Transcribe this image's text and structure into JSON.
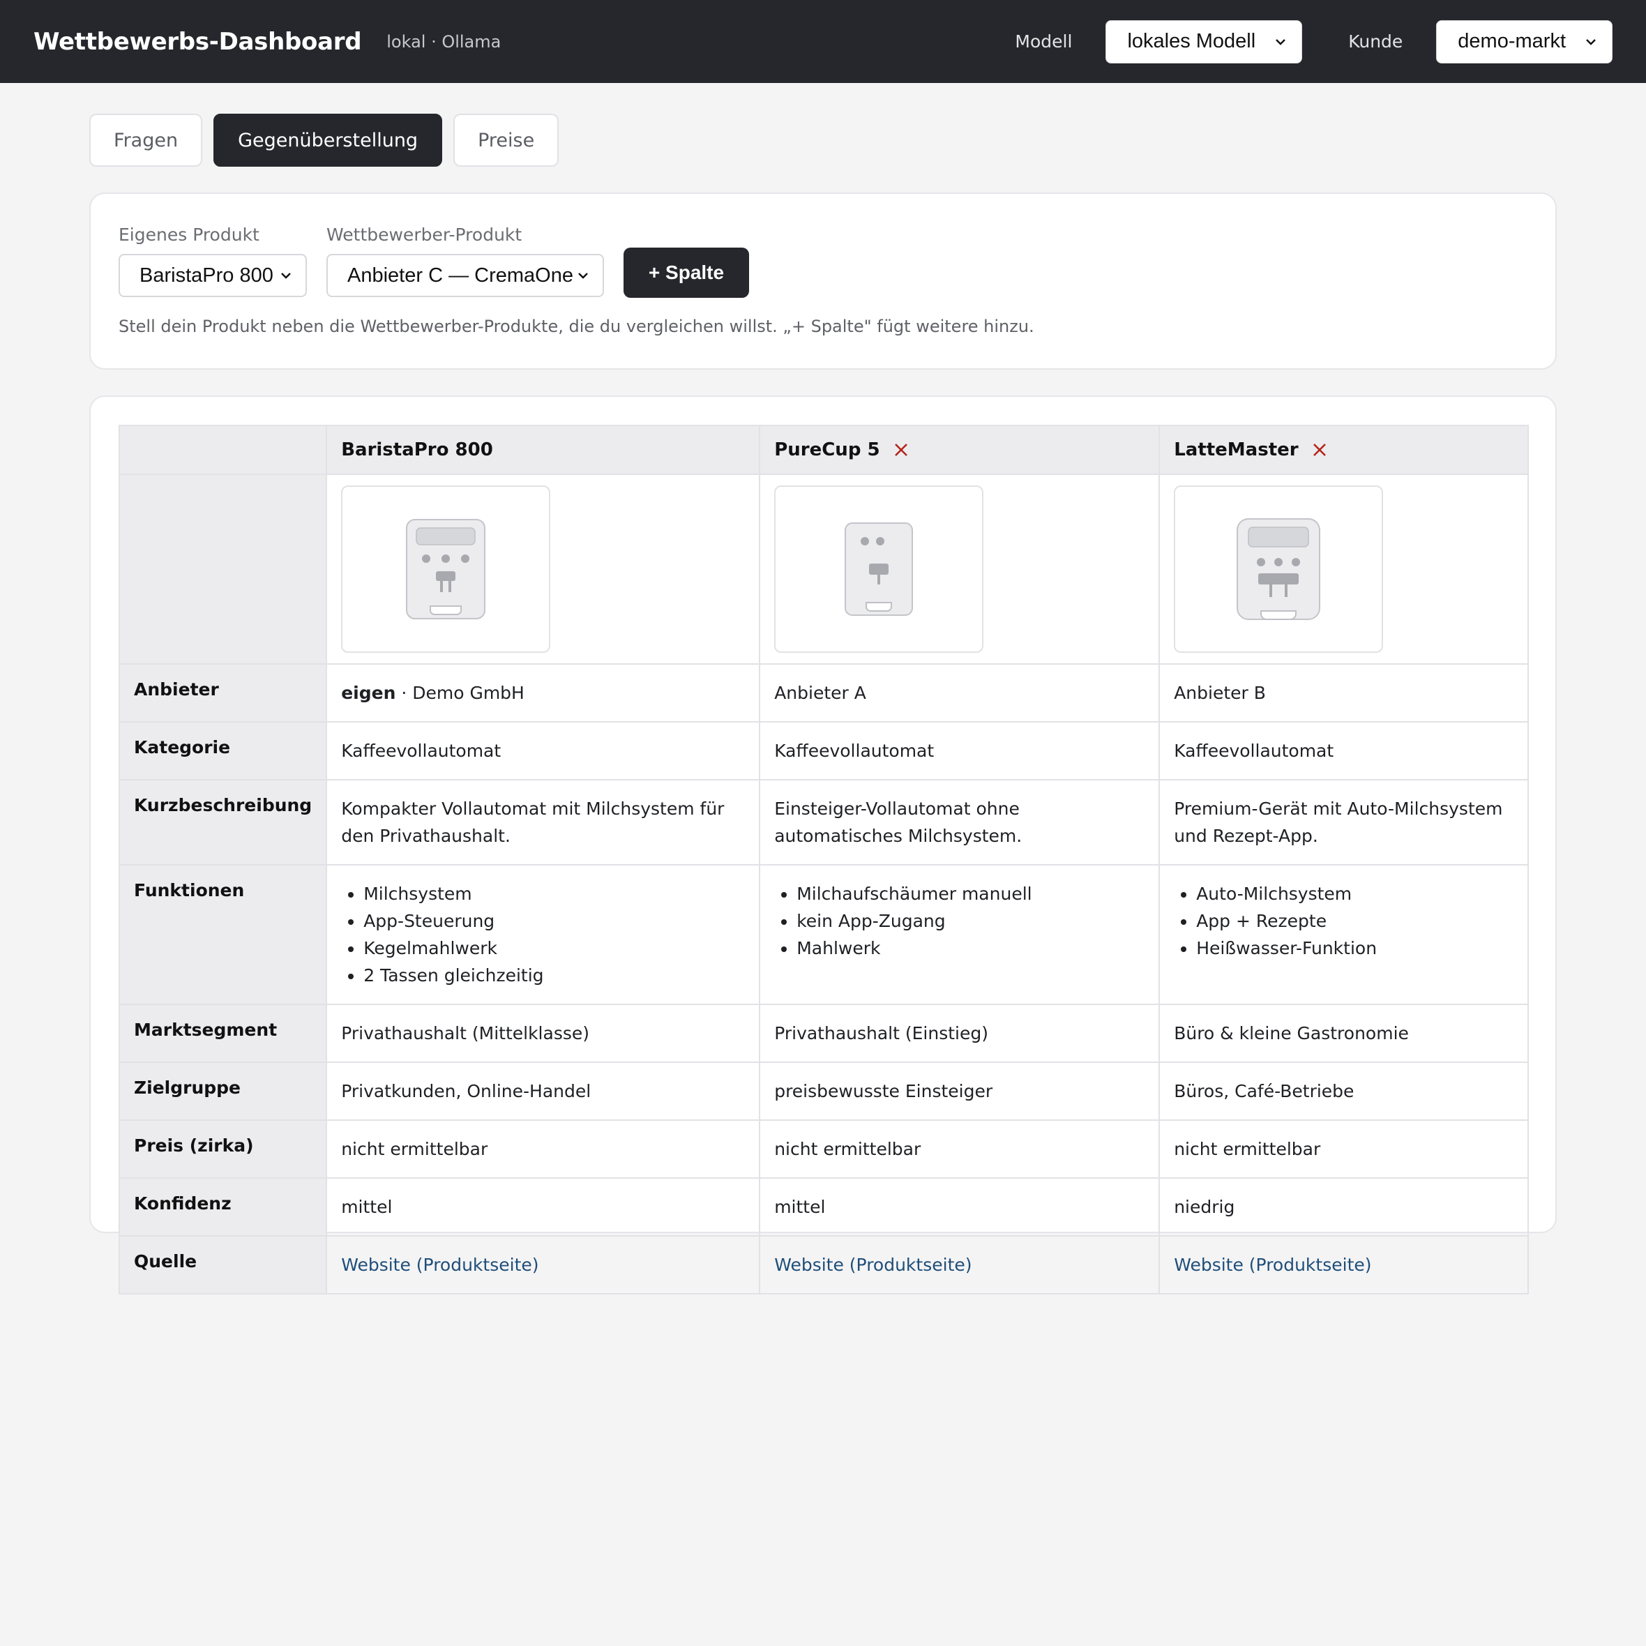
{
  "topbar": {
    "title": "Wettbewerbs-Dashboard",
    "subtitle": "lokal · Ollama",
    "model_label": "Modell",
    "model_value": "lokales Modell",
    "customer_label": "Kunde",
    "customer_value": "demo-markt"
  },
  "tabs": [
    {
      "label": "Fragen",
      "active": false
    },
    {
      "label": "Gegenüberstellung",
      "active": true
    },
    {
      "label": "Preise",
      "active": false
    }
  ],
  "filter": {
    "own_label": "Eigenes Produkt",
    "own_value": "BaristaPro 800",
    "competitor_label": "Wettbewerber-Produkt",
    "competitor_value": "Anbieter C — CremaOne",
    "add_button": "+ Spalte",
    "hint": "Stell dein Produkt neben die Wettbewerber-Produkte, die du vergleichen willst. „+ Spalte\" fügt weitere hinzu."
  },
  "table": {
    "rows": {
      "anbieter": "Anbieter",
      "kategorie": "Kategorie",
      "kurzbeschreibung": "Kurzbeschreibung",
      "funktionen": "Funktionen",
      "marktsegment": "Marktsegment",
      "zielgruppe": "Zielgruppe",
      "preis": "Preis (zirka)",
      "konfidenz": "Konfidenz",
      "quelle": "Quelle"
    },
    "columns": [
      {
        "name": "BaristaPro 800",
        "removable": false,
        "anbieter_prefix": "eigen",
        "anbieter": " · Demo GmbH",
        "kategorie": "Kaffeevollautomat",
        "kurzbeschreibung": "Kompakter Vollautomat mit Milchsystem für den Privathaushalt.",
        "funktionen": [
          "Milchsystem",
          "App-Steuerung",
          "Kegelmahlwerk",
          "2 Tassen gleichzeitig"
        ],
        "marktsegment": "Privathaushalt (Mittelklasse)",
        "zielgruppe": "Privatkunden, Online-Handel",
        "preis": "nicht ermittelbar",
        "konfidenz": "mittel",
        "quelle": "Website (Produktseite)",
        "icon": "coffee-machine-icon"
      },
      {
        "name": "PureCup 5",
        "removable": true,
        "anbieter_prefix": "",
        "anbieter": "Anbieter A",
        "kategorie": "Kaffeevollautomat",
        "kurzbeschreibung": "Einsteiger-Vollautomat ohne automatisches Milchsystem.",
        "funktionen": [
          "Milchaufschäumer manuell",
          "kein App-Zugang",
          "Mahlwerk"
        ],
        "marktsegment": "Privathaushalt (Einstieg)",
        "zielgruppe": "preisbewusste Einsteiger",
        "preis": "nicht ermittelbar",
        "konfidenz": "mittel",
        "quelle": "Website (Produktseite)",
        "icon": "coffee-machine-icon"
      },
      {
        "name": "LatteMaster",
        "removable": true,
        "anbieter_prefix": "",
        "anbieter": "Anbieter B",
        "kategorie": "Kaffeevollautomat",
        "kurzbeschreibung": "Premium-Gerät mit Auto-Milchsystem und Rezept-App.",
        "funktionen": [
          "Auto-Milchsystem",
          "App + Rezepte",
          "Heißwasser-Funktion"
        ],
        "marktsegment": "Büro & kleine Gastronomie",
        "zielgruppe": "Büros, Café-Betriebe",
        "preis": "nicht ermittelbar",
        "konfidenz": "niedrig",
        "quelle": "Website (Produktseite)",
        "icon": "coffee-machine-icon"
      }
    ]
  },
  "colors": {
    "topbar_bg": "#26272c",
    "accent_dark": "#26272c",
    "remove_red": "#b42318",
    "link_blue": "#1f4e79"
  }
}
